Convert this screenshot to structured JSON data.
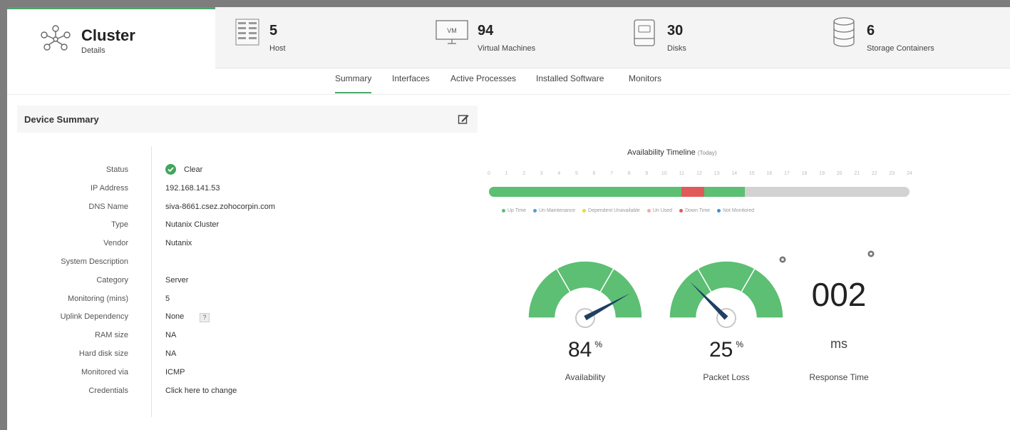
{
  "stats": {
    "cluster": {
      "title": "Cluster",
      "sub": "Details",
      "icon": "cluster-icon"
    },
    "host": {
      "count": "5",
      "label": "Host",
      "icon": "host-icon"
    },
    "vms": {
      "count": "94",
      "label": "Virtual Machines",
      "icon": "vm-icon",
      "badge": "VM"
    },
    "disks": {
      "count": "30",
      "label": "Disks",
      "icon": "disk-icon"
    },
    "storage": {
      "count": "6",
      "label": "Storage Containers",
      "icon": "storage-icon"
    }
  },
  "tabs": [
    "Summary",
    "Interfaces",
    "Active Processes",
    "Installed Software",
    "Monitors"
  ],
  "active_tab": "Summary",
  "device_summary": {
    "title": "Device Summary",
    "rows": [
      {
        "key": "Status",
        "value": "Clear"
      },
      {
        "key": "IP Address",
        "value": "192.168.141.53"
      },
      {
        "key": "DNS Name",
        "value": "siva-8661.csez.zohocorpin.com"
      },
      {
        "key": "Type",
        "value": "Nutanix Cluster"
      },
      {
        "key": "Vendor",
        "value": "Nutanix"
      },
      {
        "key": "System Description",
        "value": ""
      },
      {
        "key": "Category",
        "value": "Server"
      },
      {
        "key": "Monitoring (mins)",
        "value": "5"
      },
      {
        "key": "Uplink Dependency",
        "value": "None"
      },
      {
        "key": "RAM size",
        "value": "NA"
      },
      {
        "key": "Hard disk size",
        "value": "NA"
      },
      {
        "key": "Monitored via",
        "value": "ICMP"
      },
      {
        "key": "Credentials",
        "value": "Click here to change"
      }
    ],
    "uplink_badge": "?"
  },
  "timeline": {
    "title": "Availability Timeline",
    "period": "(Today)",
    "hours": [
      "0",
      "1",
      "2",
      "3",
      "4",
      "5",
      "6",
      "7",
      "8",
      "9",
      "10",
      "11",
      "12",
      "13",
      "14",
      "15",
      "16",
      "17",
      "18",
      "19",
      "20",
      "21",
      "22",
      "23",
      "24"
    ],
    "segments": [
      {
        "state": "up",
        "from": 0,
        "to": 11,
        "color": "#5cbf73"
      },
      {
        "state": "down",
        "from": 11,
        "to": 12.3,
        "color": "#e05a5a"
      },
      {
        "state": "up",
        "from": 12.3,
        "to": 14.6,
        "color": "#5cbf73"
      }
    ],
    "legend": [
      {
        "label": "Up Time",
        "color": "#5cbf73"
      },
      {
        "label": "Un Maintenance",
        "color": "#4aa0d8"
      },
      {
        "label": "Dependent Unavailable",
        "color": "#f0d43a"
      },
      {
        "label": "Un Used",
        "color": "#f2a9a9"
      },
      {
        "label": "Down Time",
        "color": "#e05a5a"
      },
      {
        "label": "Not Monitored",
        "color": "#3a8fe0"
      }
    ]
  },
  "gauges": {
    "availability": {
      "value": "84",
      "unit": "%",
      "label": "Availability",
      "fraction": 0.84
    },
    "packet_loss": {
      "value": "25",
      "unit": "%",
      "label": "Packet Loss",
      "fraction": 0.25
    }
  },
  "response_time": {
    "value": "002",
    "unit": "ms",
    "label": "Response Time"
  },
  "colors": {
    "accent": "#4ca66a",
    "gauge_fill": "#5cbf73",
    "needle": "#1f3f63"
  }
}
